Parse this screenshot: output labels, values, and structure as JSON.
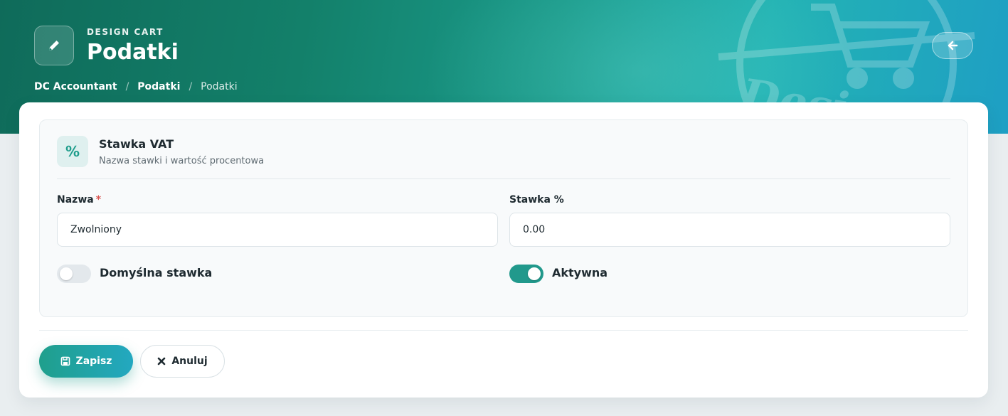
{
  "header": {
    "eyebrow": "DESIGN CART",
    "title": "Podatki",
    "breadcrumb": [
      "DC Accountant",
      "Podatki",
      "Podatki"
    ],
    "breadcrumb_separator": "/",
    "watermark_text": "Design Cart"
  },
  "section": {
    "icon_glyph": "%",
    "title": "Stawka VAT",
    "subtitle": "Nazwa stawki i wartość procentowa"
  },
  "form": {
    "name": {
      "label": "Nazwa",
      "required_mark": "*",
      "value": "Zwolniony"
    },
    "rate": {
      "label": "Stawka %",
      "value": "0.00"
    },
    "default_toggle": {
      "label": "Domyślna stawka",
      "checked": false
    },
    "active_toggle": {
      "label": "Aktywna",
      "checked": true
    }
  },
  "actions": {
    "save_label": "Zapisz",
    "cancel_label": "Anuluj"
  },
  "colors": {
    "accent": "#21998c",
    "required": "#d9534f"
  },
  "icons": {
    "header": "pencil-icon",
    "back": "arrow-left-icon",
    "section": "percent-icon",
    "save": "floppy-disk-icon",
    "cancel": "x-icon"
  }
}
